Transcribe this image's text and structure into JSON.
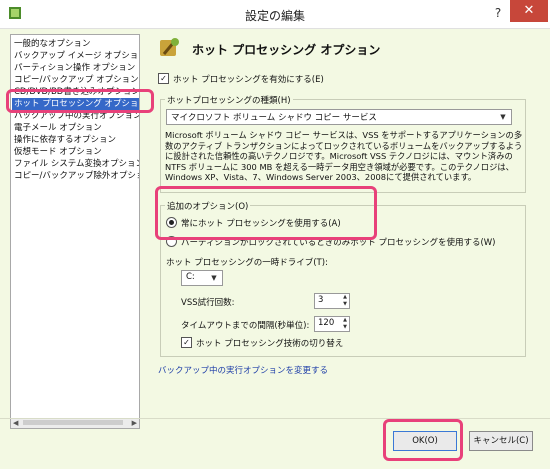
{
  "window": {
    "title": "設定の編集",
    "help_label": "?",
    "close_label": "✕"
  },
  "sidebar": {
    "items": [
      {
        "label": "一般的なオプション",
        "selected": false
      },
      {
        "label": "バックアップ イメージ オプション",
        "selected": false
      },
      {
        "label": "パーティション操作 オプション",
        "selected": false
      },
      {
        "label": "コピー/バックアップ オプション",
        "selected": false
      },
      {
        "label": "CD/DVD/BD書き込みオプション",
        "selected": false
      },
      {
        "label": "ホット プロセッシング オプション",
        "selected": true
      },
      {
        "label": "バックアップ中の実行オプション",
        "selected": false
      },
      {
        "label": "電子メール オプション",
        "selected": false
      },
      {
        "label": "操作に依存するオプション",
        "selected": false
      },
      {
        "label": "仮想モード オプション",
        "selected": false
      },
      {
        "label": "ファイル システム変換オプション",
        "selected": false
      },
      {
        "label": "コピー/バックアップ除外オプション",
        "selected": false
      }
    ],
    "scroll_left": "◀",
    "scroll_right": "▶"
  },
  "panel": {
    "title": "ホット プロセッシング オプション",
    "enable_label": "ホット プロセッシングを有効にする(E)",
    "enable_checked": true,
    "type_group_label": "ホットプロセッシングの種類(H)",
    "type_value": "マイクロソフト ボリューム シャドウ コピー サービス",
    "description": "Microsoft ボリューム シャドウ コピー サービスは、VSS をサポートするアプリケーションの多数のアクティブ トランザクションによってロックされているボリュームをバックアップするように設計された信頼性の高いテクノロジです。Microsoft VSS テクノロジには、マウント済みの NTFS ボリュームに 300 MB を超える一時データ用空き領域が必要です。このテクノロジは、Windows XP、Vista、7、Windows Server 2003、2008にて提供されています。",
    "extra_group_label": "追加のオプション(O)",
    "radio_always": "常にホット プロセッシングを使用する(A)",
    "radio_locked": "パーティションがロックされているときのみホット プロセッシングを使用する(W)",
    "temp_drive_label": "ホット プロセッシングの一時ドライブ(T):",
    "temp_drive_value": "C:",
    "vss_retry_label": "VSS試行回数:",
    "vss_retry_value": "3",
    "timeout_label": "タイムアウトまでの間隔(秒単位):",
    "timeout_value": "120",
    "switch_label": "ホット プロセッシング技術の切り替え",
    "switch_checked": true,
    "link_label": "バックアップ中の実行オプションを変更する"
  },
  "buttons": {
    "ok": "OK(O)",
    "cancel": "キャンセル(C)"
  },
  "colors": {
    "background": "#f3f9e3",
    "selection": "#3568c8",
    "highlight": "#e8417a",
    "close": "#c7473a",
    "link": "#1f3fa8"
  }
}
